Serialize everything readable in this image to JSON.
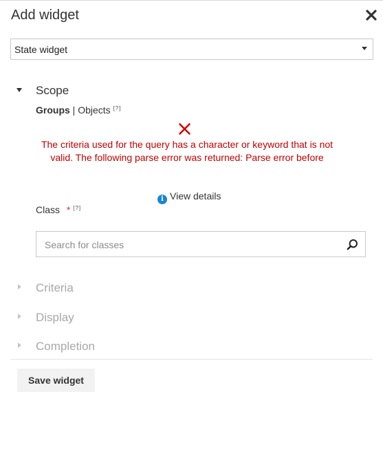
{
  "dialog": {
    "title": "Add widget",
    "close_icon": "close-icon"
  },
  "widget_type": {
    "selected": "State widget"
  },
  "scope": {
    "label": "Scope",
    "tab_groups": "Groups",
    "separator": "|",
    "tab_objects": "Objects",
    "help_marker": "[?]",
    "error": {
      "icon": "error-x-icon",
      "message": "The criteria used for the query has a character or keyword that is not valid. The following parse error was returned: Parse error before",
      "color": "#c00000"
    },
    "view_details": "View details",
    "class_label": "Class",
    "required_marker": "*",
    "class_help_marker": "[?]",
    "search": {
      "placeholder": "Search for classes",
      "value": ""
    }
  },
  "sections": {
    "criteria": "Criteria",
    "display": "Display",
    "completion": "Completion"
  },
  "footer": {
    "save_label": "Save widget"
  },
  "colors": {
    "error_red": "#c00000",
    "info_blue": "#1a86d0",
    "required_red": "#d9322f"
  }
}
